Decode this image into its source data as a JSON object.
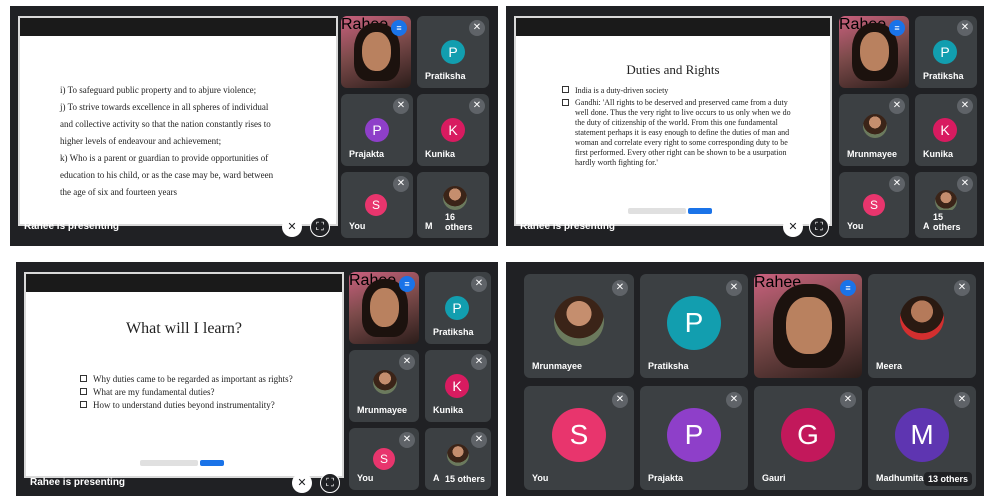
{
  "panels": [
    {
      "presenting_label": "Rahee is presenting",
      "slide": {
        "lines": [
          "i) To safeguard public property and to abjure violence;",
          "j) To strive towards excellence in all spheres of individual",
          "and collective activity so that the nation constantly rises to",
          "higher levels of endeavour and achievement;",
          "k) Who is a parent or guardian to provide opportunities of",
          "education to his child, or as the case may be, ward between",
          "the age of six and fourteen years"
        ]
      },
      "tiles": {
        "rahee": "Rahee",
        "t2": "Pratiksha",
        "t3": "Prajakta",
        "t4": "Kunika",
        "t5": "You",
        "t6_prefix": "M",
        "others": "16 others"
      },
      "initials": {
        "t2": "P",
        "t3": "P",
        "t4": "K",
        "t5": "S"
      }
    },
    {
      "presenting_label": "Rahee is presenting",
      "slide": {
        "title": "Duties and Rights",
        "bullets": [
          "India is a duty-driven society",
          "Gandhi: 'All rights to be deserved and preserved came from a duty well done. Thus the very right to live occurs to us only when we do the duty of citizenship of the world. From this one fundamental statement perhaps it is easy enough to define the duties of man and woman and correlate every right to some corresponding duty to be first performed. Every other right can be shown to be a usurpation hardly worth fighting for.'"
        ]
      },
      "tiles": {
        "rahee": "Rahee",
        "t2": "Pratiksha",
        "t3": "Mrunmayee",
        "t4": "Kunika",
        "t5": "You",
        "t6_prefix": "A",
        "others": "15 others"
      },
      "initials": {
        "t2": "P",
        "t4": "K",
        "t5": "S"
      }
    },
    {
      "presenting_label": "Rahee is presenting",
      "slide": {
        "title": "What will I learn?",
        "bullets": [
          "Why duties came to be regarded as important as rights?",
          "What are my fundamental duties?",
          "How to understand duties beyond instrumentality?"
        ]
      },
      "tiles": {
        "rahee": "Rahee",
        "t2": "Pratiksha",
        "t3": "Mrunmayee",
        "t4": "Kunika",
        "t5": "You",
        "t6_prefix": "A",
        "others": "15 others"
      },
      "initials": {
        "t2": "P",
        "t4": "K",
        "t5": "S"
      }
    },
    {
      "tiles": [
        {
          "name": "Mrunmayee"
        },
        {
          "name": "Pratiksha",
          "initial": "P"
        },
        {
          "name": "Rahee"
        },
        {
          "name": "Meera"
        },
        {
          "name": "You",
          "initial": "S"
        },
        {
          "name": "Prajakta",
          "initial": "P"
        },
        {
          "name": "Gauri",
          "initial": "G"
        },
        {
          "name": "Madhumita",
          "initial": "M"
        }
      ],
      "others": "13 others"
    }
  ],
  "colors": {
    "pratiksha": "#129eaf",
    "prajakta": "#8e3fc9",
    "kunika": "#d81b60",
    "you": "#e8356d",
    "gauri": "#c2185b",
    "madhumita": "#5e35b1",
    "speaking": "#1a73e8",
    "meet_bg": "#202124",
    "tile_bg": "#3c4043"
  },
  "icons": {
    "muted": "mic-off-icon",
    "speaking": "audio-wave-icon",
    "mic_control": "mic-off-icon",
    "layout_control": "fullscreen-icon"
  }
}
